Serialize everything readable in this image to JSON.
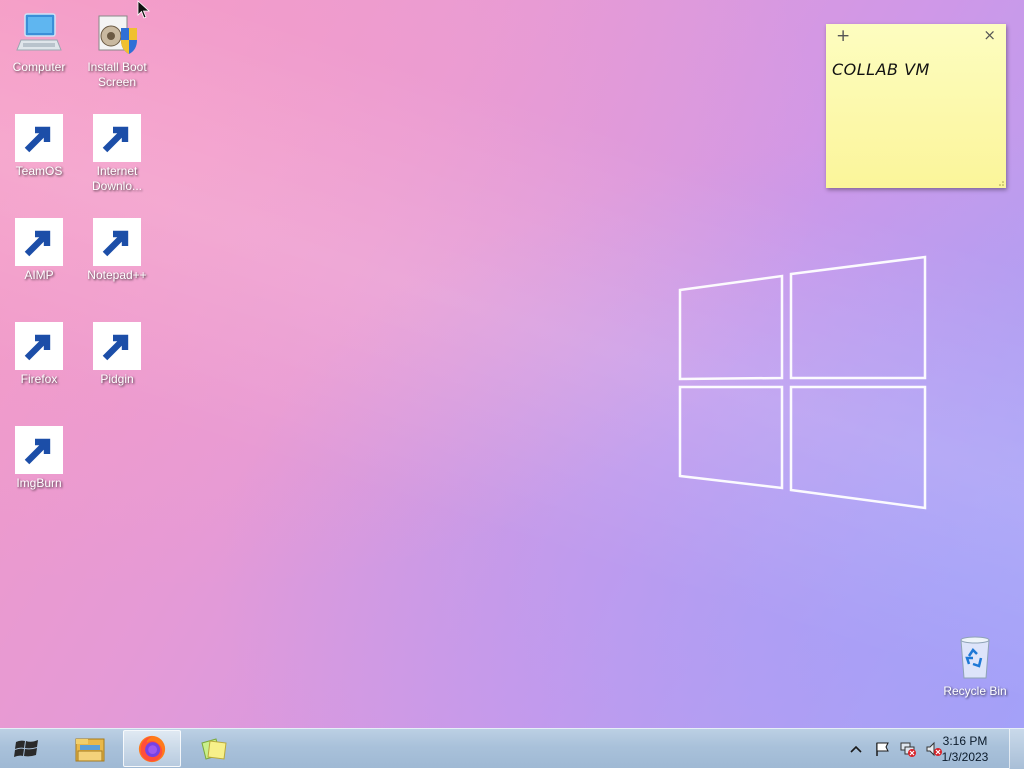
{
  "desktop": {
    "icons": [
      {
        "label": "Computer",
        "icon": "computer-icon"
      },
      {
        "label": "Install Boot Screen",
        "icon": "install-boot-screen-icon"
      },
      {
        "label": "TeamOS",
        "icon": "teamos-folder-icon"
      },
      {
        "label": "Internet Downlo...",
        "icon": "internet-download-manager-icon"
      },
      {
        "label": "AIMP",
        "icon": "aimp-icon"
      },
      {
        "label": "Notepad++",
        "icon": "notepad-plus-plus-icon"
      },
      {
        "label": "Firefox",
        "icon": "firefox-icon"
      },
      {
        "label": "Pidgin",
        "icon": "pidgin-icon"
      },
      {
        "label": "ImgBurn",
        "icon": "imgburn-icon"
      },
      {
        "label": "Recycle Bin",
        "icon": "recycle-bin-icon"
      }
    ]
  },
  "sticky_note": {
    "add_symbol": "+",
    "close_symbol": "×",
    "text": "COLLAB VM",
    "color": "#fbf59a"
  },
  "taskbar": {
    "start": {
      "icon": "windows-start-icon"
    },
    "pinned": [
      {
        "name": "File Explorer",
        "icon": "file-explorer-icon",
        "active": false
      },
      {
        "name": "Firefox",
        "icon": "firefox-icon",
        "active": true
      },
      {
        "name": "Sticky Notes",
        "icon": "sticky-notes-icon",
        "active": false
      }
    ],
    "tray": {
      "icons": [
        "chevron-up-icon",
        "action-center-flag-icon",
        "network-error-icon",
        "volume-muted-icon"
      ],
      "time": "3:16 PM",
      "date": "1/3/2023"
    }
  }
}
